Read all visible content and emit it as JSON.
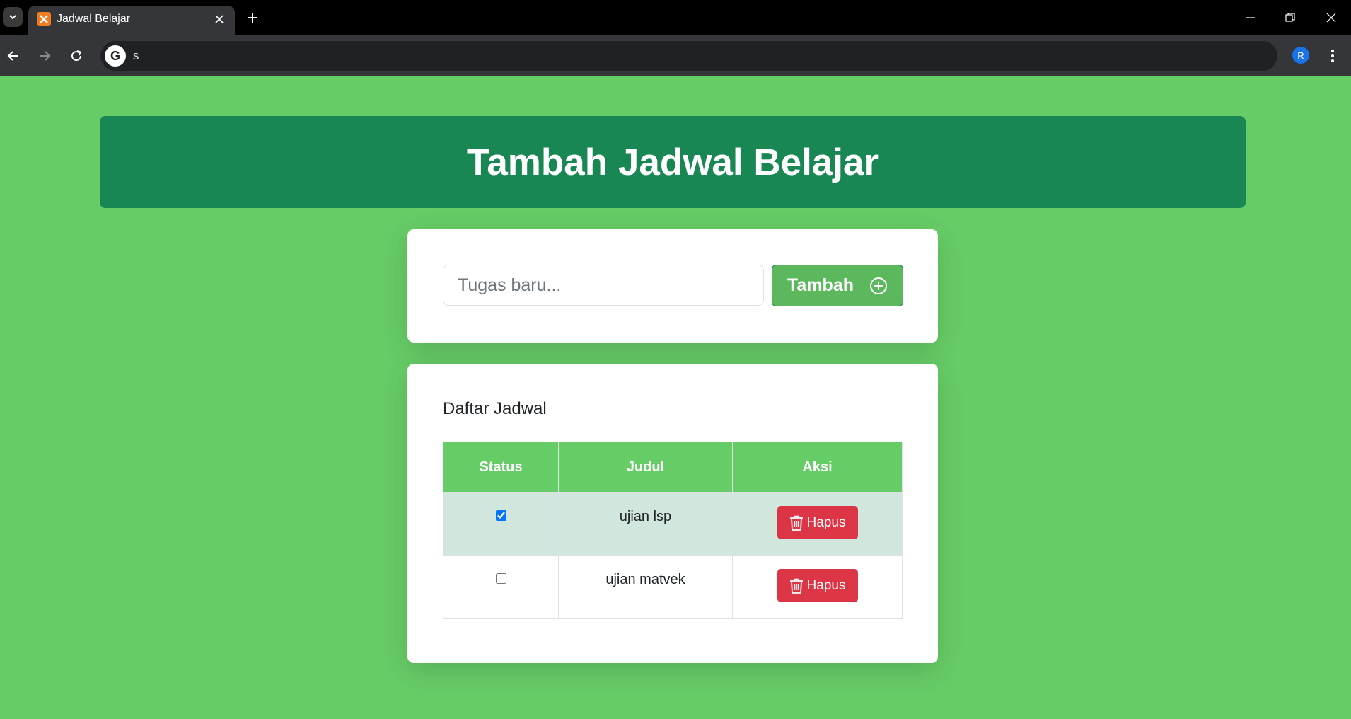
{
  "browser": {
    "tab_title": "Jadwal Belajar",
    "address": "s",
    "profile_initial": "R"
  },
  "header": {
    "title": "Tambah Jadwal Belajar"
  },
  "form": {
    "placeholder": "Tugas baru...",
    "value": "",
    "add_label": "Tambah"
  },
  "list": {
    "title": "Daftar Jadwal",
    "columns": [
      "Status",
      "Judul",
      "Aksi"
    ],
    "rows": [
      {
        "done": true,
        "title": "ujian lsp",
        "action_label": "Hapus"
      },
      {
        "done": false,
        "title": "ujian matvek",
        "action_label": "Hapus"
      }
    ]
  },
  "colors": {
    "page_bg": "#66cc66",
    "header_bg": "#198754",
    "add_button": "#5cb85c",
    "delete_button": "#dc3545",
    "done_row": "#d1e7dd"
  }
}
